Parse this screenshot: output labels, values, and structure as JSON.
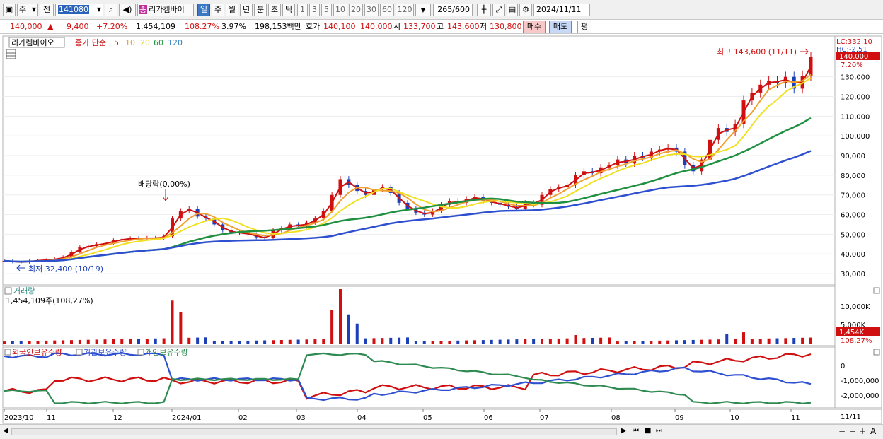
{
  "toolbar": {
    "period_unit": "주",
    "market": "전",
    "code": "141080",
    "badge": "종",
    "stock_name": "리가켐바이",
    "tabs": [
      "일",
      "주",
      "월",
      "년",
      "분",
      "초",
      "틱"
    ],
    "active_tab": "일",
    "intervals": [
      "1",
      "3",
      "5",
      "10",
      "20",
      "30",
      "60",
      "120"
    ],
    "count": "265",
    "count_total": "/600",
    "date": "2024/11/11"
  },
  "infobar": {
    "price": "140,000",
    "change": "9,400",
    "change_pct": "+7.20%",
    "volume": "1,454,109",
    "vol_ratio": "108.27%",
    "turnover": "3.97%",
    "amount": "198,153백만",
    "ask_label": "호가",
    "ask": "140,100",
    "bid": "140,000",
    "open_label": "시",
    "open": "133,700",
    "high_label": "고",
    "high": "143,600",
    "low_label": "저",
    "low": "130,800",
    "buy_label": "매수",
    "sell_label": "매도",
    "avg_label": "평"
  },
  "price_panel": {
    "title": "리가켐바이오",
    "ma_label": "종가 단순",
    "ma_periods": [
      "5",
      "10",
      "20",
      "60",
      "120"
    ],
    "ma_colors": [
      "#d01010",
      "#f0a030",
      "#f0e020",
      "#1e9040",
      "#2e50d0"
    ],
    "dividend_label": "배당락(0.00%)",
    "high_label": "최고 143,600 (11/11)",
    "low_label": "최저 32,400 (10/19)",
    "lc_label": "LC:332.10",
    "hc_label": "HC:-2.51",
    "current_price": "140,000",
    "current_pct": "7.20%",
    "y_ticks": [
      "130,000",
      "120,000",
      "110,000",
      "100,000",
      "90,000",
      "80,000",
      "70,000",
      "60,000",
      "50,000",
      "40,000",
      "30,000"
    ]
  },
  "volume_panel": {
    "title": "거래량",
    "value": "1,454,109주(108,27%)",
    "y_ticks": [
      "10,000K",
      "5,000K"
    ],
    "current": "1,454K",
    "current_pct": "108,27%"
  },
  "holdings_panel": {
    "legend": [
      "외국인보유수량",
      "기관보유수량",
      "개인보유수량"
    ],
    "colors": [
      "#d01010",
      "#2e50d0",
      "#2e8a50"
    ],
    "y_ticks": [
      "0",
      "-1,000,000",
      "-2,000,000"
    ]
  },
  "x_axis": {
    "labels": [
      "2023/10",
      "11",
      "12",
      "2024/01",
      "02",
      "03",
      "04",
      "05",
      "06",
      "07",
      "08",
      "09",
      "10",
      "11"
    ],
    "current": "11/11"
  },
  "chart_data": {
    "type": "candlestick",
    "price_series": [
      36500,
      36000,
      35800,
      36500,
      36800,
      37000,
      37500,
      38500,
      41000,
      43500,
      44000,
      45000,
      45500,
      47000,
      47500,
      48000,
      47800,
      48200,
      48000,
      49000,
      58000,
      62000,
      63000,
      59000,
      58000,
      55000,
      52000,
      51000,
      50500,
      50000,
      48500,
      48000,
      52000,
      53000,
      55000,
      54000,
      56000,
      58000,
      62000,
      70000,
      78000,
      75000,
      72000,
      70000,
      73000,
      74000,
      71000,
      66000,
      63000,
      61000,
      60000,
      62000,
      65000,
      67000,
      66000,
      68000,
      69000,
      67000,
      66000,
      65000,
      64000,
      63000,
      66000,
      65000,
      70000,
      73000,
      74000,
      75000,
      80000,
      82000,
      81000,
      84000,
      85000,
      88000,
      86000,
      90000,
      89000,
      92000,
      93000,
      94000,
      92000,
      85000,
      82000,
      88000,
      98000,
      104000,
      102000,
      106000,
      118000,
      122000,
      126000,
      128000,
      127000,
      130000,
      124000,
      130600,
      140000
    ],
    "ylim": [
      25000,
      150000
    ],
    "volume_ylim": [
      0,
      12000
    ],
    "holding_ylim": [
      -2600000,
      400000
    ]
  }
}
